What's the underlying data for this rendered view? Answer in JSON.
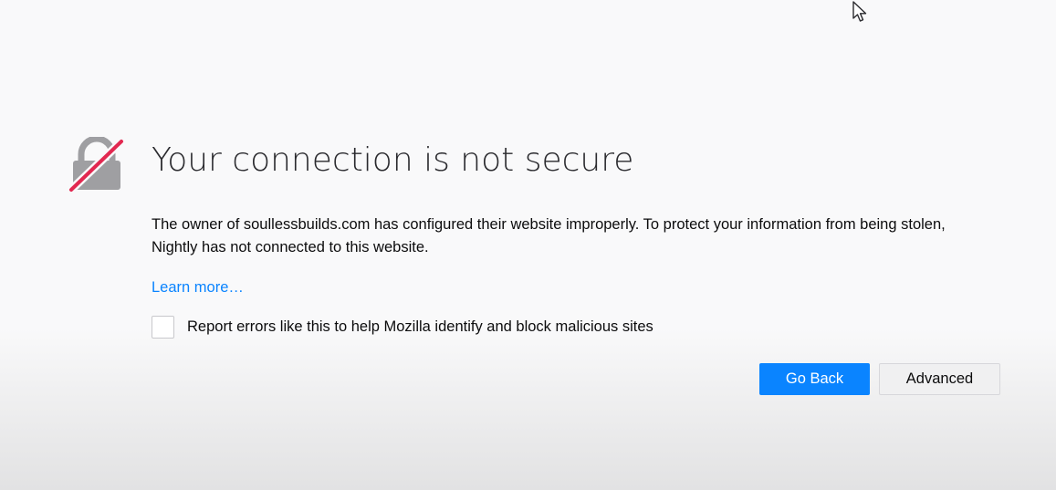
{
  "error_page": {
    "title": "Your connection is not secure",
    "description": "The owner of soullessbuilds.com has configured their website improperly. To protect your information from being stolen, Nightly has not connected to this website.",
    "learn_more": "Learn more…",
    "report_checkbox": {
      "label": "Report errors like this to help Mozilla identify and block malicious sites",
      "checked": false
    },
    "buttons": {
      "go_back": "Go Back",
      "advanced": "Advanced"
    },
    "icon": "broken-lock-icon"
  },
  "colors": {
    "primary_button": "#0a84ff",
    "link": "#0a84ff",
    "lock_gray": "#9f9fa2",
    "slash_red": "#e22850"
  }
}
